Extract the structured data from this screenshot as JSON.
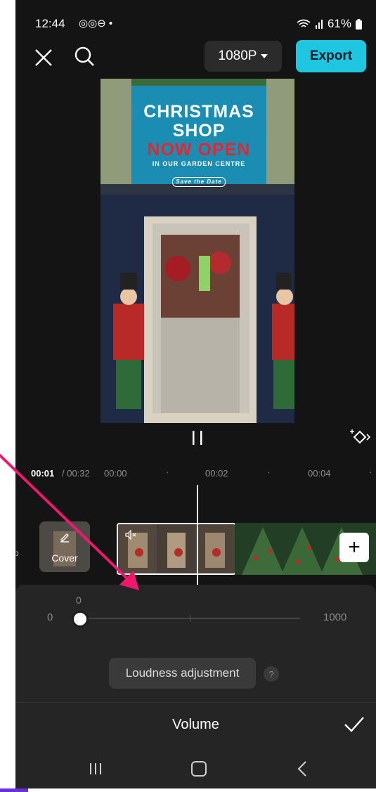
{
  "status": {
    "time": "12:44",
    "battery": "61%"
  },
  "toolbar": {
    "resolution": "1080P",
    "export_label": "Export"
  },
  "preview": {
    "sign_line1": "CHRISTMAS",
    "sign_line2": "SHOP",
    "sign_line3": "NOW OPEN",
    "sign_line4": "IN OUR GARDEN CENTRE",
    "sign_tag": "Save the Date"
  },
  "timeline": {
    "current_time": "00:01",
    "total_time": "/ 00:32",
    "ticks": [
      "00:00",
      "00:02",
      "00:04"
    ],
    "cover_label": "Cover",
    "edge_label": "p",
    "add_label": "+"
  },
  "volume_panel": {
    "current_value": "0",
    "min_label": "0",
    "max_label": "1000",
    "loudness_label": "Loudness adjustment",
    "help_label": "?",
    "title": "Volume",
    "value_fraction": 0
  },
  "colors": {
    "accent": "#1fc6df",
    "annotation_arrow": "#f0186e"
  }
}
